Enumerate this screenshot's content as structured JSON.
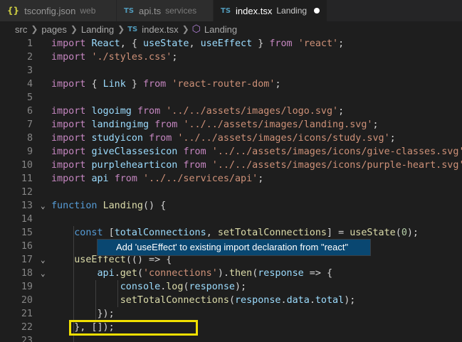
{
  "tabs": [
    {
      "icon": "{}",
      "name": "tsconfig.json",
      "desc": "web"
    },
    {
      "icon": "TS",
      "name": "api.ts",
      "desc": "services"
    },
    {
      "icon": "TS",
      "name": "index.tsx",
      "desc": "Landing"
    }
  ],
  "breadcrumb": {
    "parts": [
      "src",
      "pages",
      "Landing"
    ],
    "file_icon": "TS",
    "file": "index.tsx",
    "symbol": "Landing"
  },
  "code_lines": [
    {
      "n": "1",
      "tokens": [
        [
          "import ",
          "ctl"
        ],
        [
          "React",
          "var"
        ],
        [
          ", { ",
          "pun"
        ],
        [
          "useState",
          "var"
        ],
        [
          ", ",
          "pun"
        ],
        [
          "useEffect",
          "var"
        ],
        [
          " } ",
          "pun"
        ],
        [
          "from ",
          "ctl"
        ],
        [
          "'react'",
          "str"
        ],
        [
          ";",
          "pun"
        ]
      ]
    },
    {
      "n": "2",
      "tokens": [
        [
          "import ",
          "ctl"
        ],
        [
          "'./styles.css'",
          "str"
        ],
        [
          ";",
          "pun"
        ]
      ]
    },
    {
      "n": "3",
      "tokens": []
    },
    {
      "n": "4",
      "tokens": [
        [
          "import ",
          "ctl"
        ],
        [
          "{ ",
          "pun"
        ],
        [
          "Link",
          "var"
        ],
        [
          " } ",
          "pun"
        ],
        [
          "from ",
          "ctl"
        ],
        [
          "'react-router-dom'",
          "str"
        ],
        [
          ";",
          "pun"
        ]
      ]
    },
    {
      "n": "5",
      "tokens": []
    },
    {
      "n": "6",
      "tokens": [
        [
          "import ",
          "ctl"
        ],
        [
          "logoimg ",
          "var"
        ],
        [
          "from ",
          "ctl"
        ],
        [
          "'../../assets/images/logo.svg'",
          "str"
        ],
        [
          ";",
          "pun"
        ]
      ]
    },
    {
      "n": "7",
      "tokens": [
        [
          "import ",
          "ctl"
        ],
        [
          "landingimg ",
          "var"
        ],
        [
          "from ",
          "ctl"
        ],
        [
          "'../../assets/images/landing.svg'",
          "str"
        ],
        [
          ";",
          "pun"
        ]
      ]
    },
    {
      "n": "8",
      "tokens": [
        [
          "import ",
          "ctl"
        ],
        [
          "studyicon ",
          "var"
        ],
        [
          "from ",
          "ctl"
        ],
        [
          "'../../assets/images/icons/study.svg'",
          "str"
        ],
        [
          ";",
          "pun"
        ]
      ]
    },
    {
      "n": "9",
      "tokens": [
        [
          "import ",
          "ctl"
        ],
        [
          "giveClassesicon ",
          "var"
        ],
        [
          "from ",
          "ctl"
        ],
        [
          "'../../assets/images/icons/give-classes.svg'",
          "str"
        ],
        [
          ";",
          "pun"
        ]
      ]
    },
    {
      "n": "10",
      "tokens": [
        [
          "import ",
          "ctl"
        ],
        [
          "purplehearticon ",
          "var"
        ],
        [
          "from ",
          "ctl"
        ],
        [
          "'../../assets/images/icons/purple-heart.svg'",
          "str"
        ],
        [
          ";",
          "pun"
        ]
      ]
    },
    {
      "n": "11",
      "tokens": [
        [
          "import ",
          "ctl"
        ],
        [
          "api ",
          "var"
        ],
        [
          "from ",
          "ctl"
        ],
        [
          "'../../services/api'",
          "str"
        ],
        [
          ";",
          "pun"
        ]
      ]
    },
    {
      "n": "12",
      "tokens": []
    },
    {
      "n": "13",
      "tokens": [
        [
          "function ",
          "kw"
        ],
        [
          "Landing",
          "fn"
        ],
        [
          "() {",
          "pun"
        ]
      ]
    },
    {
      "n": "14",
      "tokens": []
    },
    {
      "n": "15",
      "tokens": [
        [
          "    const ",
          "kw"
        ],
        [
          "[",
          "pun"
        ],
        [
          "totalConnections",
          "var"
        ],
        [
          ", ",
          "pun"
        ],
        [
          "setTotalConnections",
          "fn"
        ],
        [
          "] = ",
          "pun"
        ],
        [
          "useState",
          "fn"
        ],
        [
          "(",
          "pun"
        ],
        [
          "0",
          "num"
        ],
        [
          ");",
          "pun"
        ]
      ]
    },
    {
      "n": "16",
      "tokens": []
    },
    {
      "n": "17",
      "tokens": [
        [
          "    ",
          "pun"
        ],
        [
          "useEffect",
          "fn"
        ],
        [
          "(() => {",
          "pun"
        ]
      ]
    },
    {
      "n": "18",
      "tokens": [
        [
          "        ",
          "pun"
        ],
        [
          "api",
          "var"
        ],
        [
          ".",
          "pun"
        ],
        [
          "get",
          "fn"
        ],
        [
          "(",
          "pun"
        ],
        [
          "'connections'",
          "str"
        ],
        [
          ").",
          "pun"
        ],
        [
          "then",
          "fn"
        ],
        [
          "(",
          "pun"
        ],
        [
          "response",
          "var"
        ],
        [
          " => {",
          "pun"
        ]
      ]
    },
    {
      "n": "19",
      "tokens": [
        [
          "            ",
          "pun"
        ],
        [
          "console",
          "var"
        ],
        [
          ".",
          "pun"
        ],
        [
          "log",
          "fn"
        ],
        [
          "(",
          "pun"
        ],
        [
          "response",
          "var"
        ],
        [
          ");",
          "pun"
        ]
      ]
    },
    {
      "n": "20",
      "tokens": [
        [
          "            ",
          "pun"
        ],
        [
          "setTotalConnections",
          "fn"
        ],
        [
          "(",
          "pun"
        ],
        [
          "response",
          "var"
        ],
        [
          ".",
          "pun"
        ],
        [
          "data",
          "var"
        ],
        [
          ".",
          "pun"
        ],
        [
          "total",
          "var"
        ],
        [
          ");",
          "pun"
        ]
      ]
    },
    {
      "n": "21",
      "tokens": [
        [
          "        });",
          "pun"
        ]
      ]
    },
    {
      "n": "22",
      "tokens": [
        [
          "    }, []);",
          "pun"
        ]
      ]
    },
    {
      "n": "23",
      "tokens": []
    }
  ],
  "quick_fix": {
    "label": "Add 'useEffect' to existing import declaration from \"react\""
  },
  "colors": {
    "keyword": "#569cd6",
    "import_keyword": "#c586c0",
    "string": "#ce9178",
    "variable": "#9cdcfe",
    "function": "#dcdcaa",
    "number": "#b5cea8",
    "highlight_box": "#f1e000",
    "quick_fix_bg": "#094771"
  }
}
